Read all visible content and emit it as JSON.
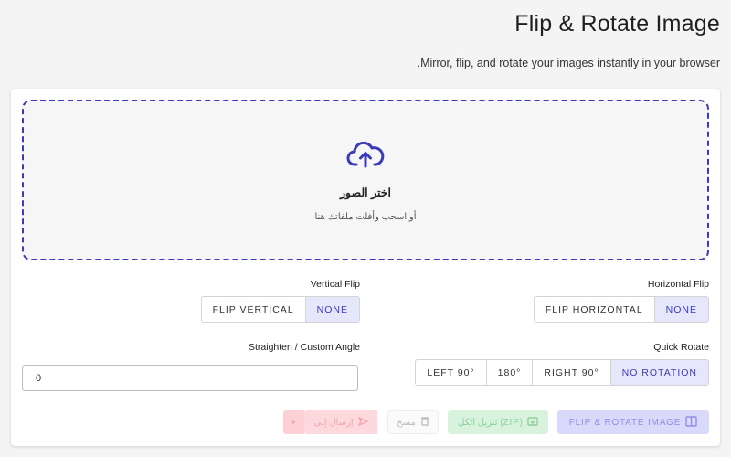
{
  "page": {
    "title": "Flip & Rotate Image",
    "subtitle": ".Mirror, flip, and rotate your images instantly in your browser"
  },
  "dropzone": {
    "icon": "cloud-upload-icon",
    "title": "اختر الصور",
    "subtitle": "أو اسحب وأفلت ملفاتك هنا"
  },
  "horizontal_flip": {
    "label": "Horizontal Flip",
    "options": [
      "FLIP HORIZONTAL",
      "NONE"
    ],
    "selected": "NONE"
  },
  "vertical_flip": {
    "label": "Vertical Flip",
    "options": [
      "FLIP VERTICAL",
      "NONE"
    ],
    "selected": "NONE"
  },
  "quick_rotate": {
    "label": "Quick Rotate",
    "options": [
      "LEFT 90°",
      "180°",
      "RIGHT 90°",
      "NO ROTATION"
    ],
    "selected": "NO ROTATION"
  },
  "custom_angle": {
    "label": "Straighten / Custom Angle",
    "value": "0"
  },
  "actions": {
    "apply": "FLIP & ROTATE IMAGE",
    "download_zip": "تنزيل الكل (ZIP)",
    "clear": "مسح",
    "send_to": "إرسال إلى"
  },
  "colors": {
    "accent": "#3b3bb8",
    "selected_bg": "#e7e7fb",
    "zip_green": "#d8f2dd",
    "send_red": "#fdd9dd"
  }
}
